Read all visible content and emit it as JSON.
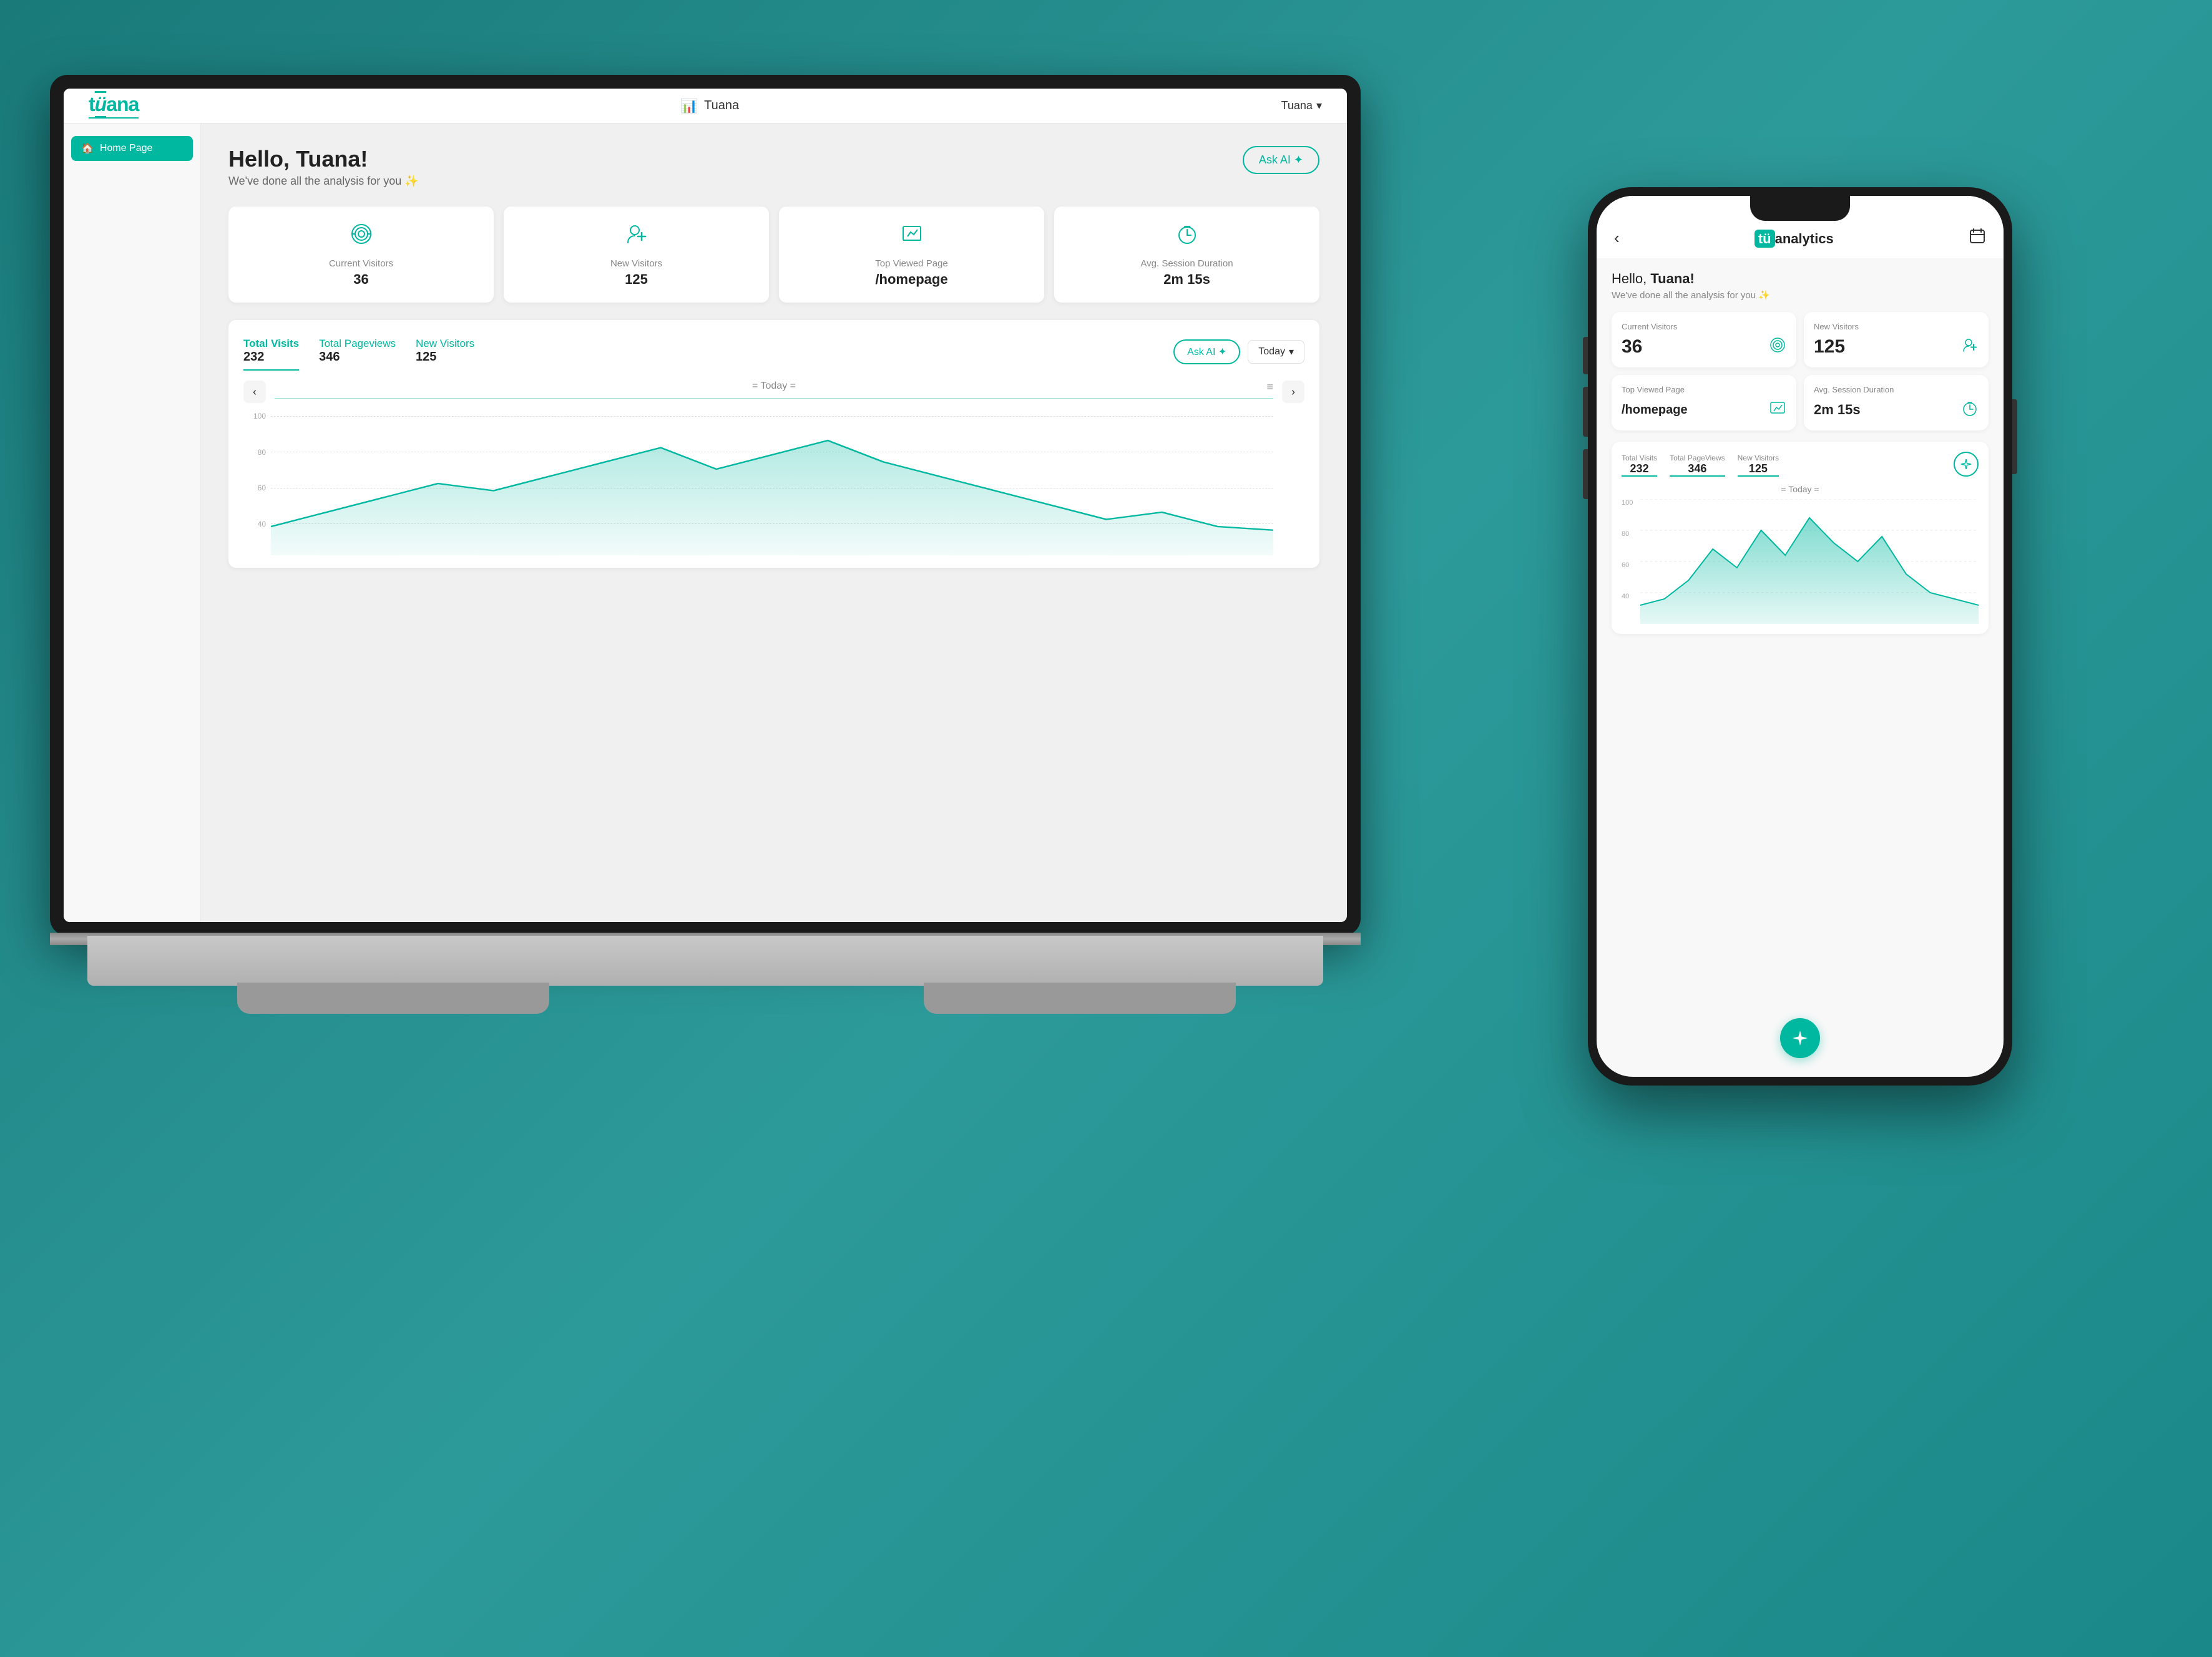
{
  "background_color": "#2d8a8a",
  "laptop": {
    "topbar": {
      "logo": "tüana",
      "title": "Tuana",
      "user_label": "Tuana",
      "chevron": "▾"
    },
    "sidebar": {
      "items": [
        {
          "label": "Home Page",
          "icon": "🏠",
          "active": true
        }
      ]
    },
    "main": {
      "greeting": "Hello, Tuana!",
      "greeting_sub": "We've done all the analysis for you ✨",
      "ask_ai_label": "Ask AI ✦",
      "stats": [
        {
          "icon": "((·))",
          "label": "Current Visitors",
          "value": "36"
        },
        {
          "icon": "👤+",
          "label": "New Visitors",
          "value": "125"
        },
        {
          "icon": "🖼",
          "label": "Top Viewed Page",
          "value": "/homepage"
        },
        {
          "icon": "⏱",
          "label": "Avg. Session Duration",
          "value": "2m 15s"
        }
      ],
      "chart": {
        "tabs": [
          {
            "label": "Total Visits",
            "value": "232",
            "active": true
          },
          {
            "label": "Total Pageviews",
            "value": "346",
            "active": false
          },
          {
            "label": "New Visitors",
            "value": "125",
            "active": false
          }
        ],
        "ask_ai_label": "Ask AI ✦",
        "period_label": "Today",
        "today_marker": "= Today =",
        "nav_left": "‹",
        "nav_right": "›",
        "y_labels": [
          "100",
          "80",
          "60",
          "40"
        ],
        "chart_icon": "≡"
      }
    }
  },
  "phone": {
    "topbar": {
      "back_icon": "‹",
      "logo": "tüanalytics",
      "calendar_icon": "📅"
    },
    "main": {
      "greeting": "Hello, Tuana!",
      "greeting_bold": "Tuana!",
      "greeting_sub": "We've done all the analysis for you ✨",
      "stats": [
        {
          "label": "Current Visitors",
          "value": "36",
          "icon": "((·))"
        },
        {
          "label": "New Visitors",
          "value": "125",
          "icon": "👤+"
        },
        {
          "label": "Top Viewed Page",
          "value": "/homepage",
          "icon": "🖼"
        },
        {
          "label": "Avg. Session Duration",
          "value": "2m 15s",
          "icon": "⏱"
        }
      ],
      "chart": {
        "tabs": [
          {
            "label": "Total Visits",
            "value": "232"
          },
          {
            "label": "Total PageViews",
            "value": "346"
          },
          {
            "label": "New Visitors",
            "value": "125"
          }
        ],
        "today_marker": "= Today =",
        "y_labels": [
          "100",
          "80",
          "60",
          "40"
        ],
        "fab_icon": "✦"
      }
    }
  }
}
